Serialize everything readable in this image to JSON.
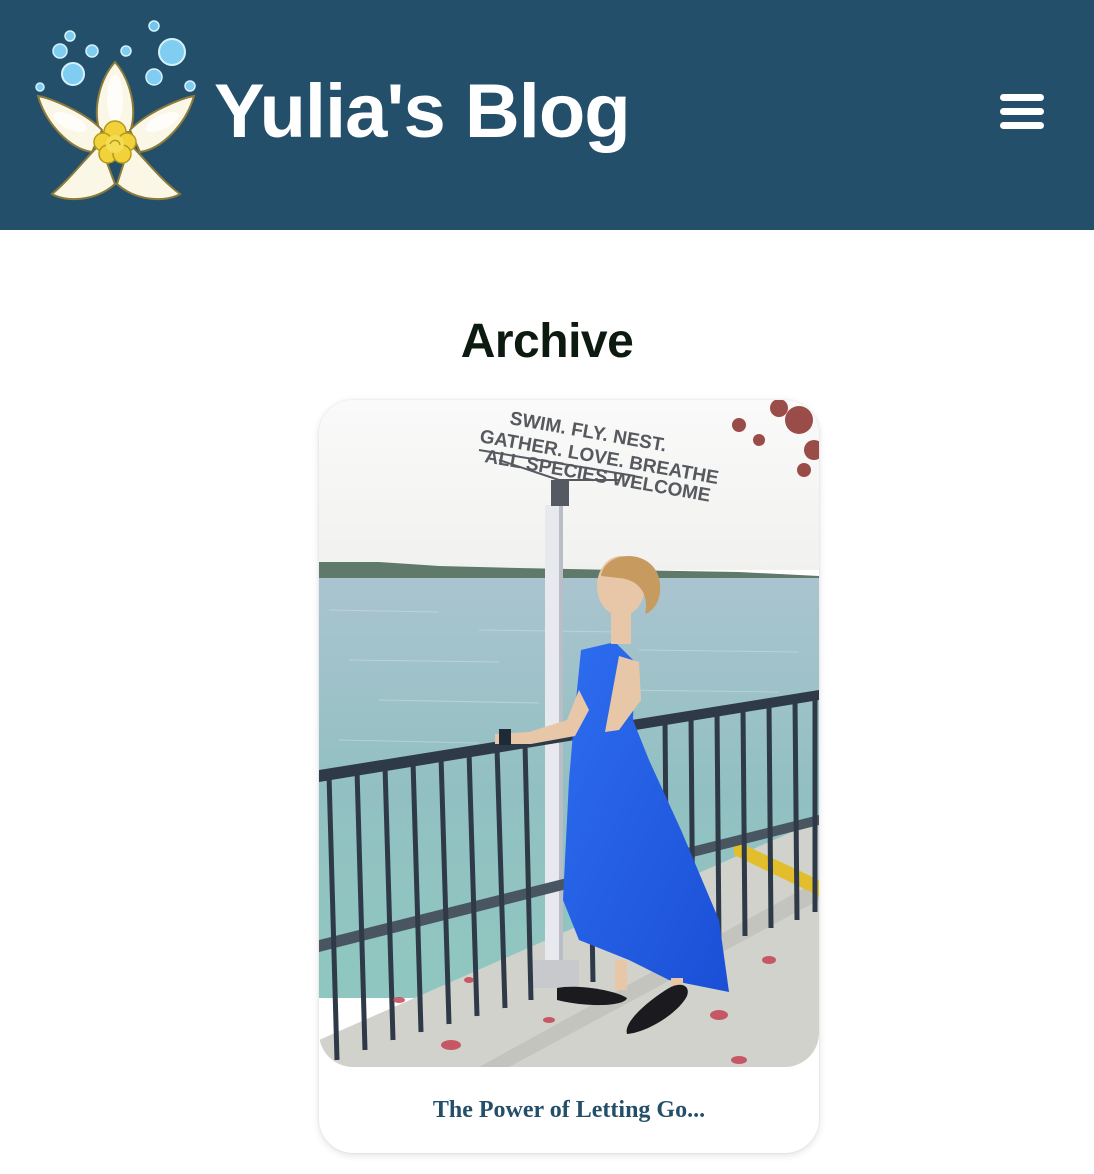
{
  "header": {
    "site_title": "Yulia's Blog",
    "logo_icon": "flower-with-bubbles-icon",
    "menu_icon": "hamburger-menu-icon",
    "background_color": "#244f6b"
  },
  "main": {
    "heading": "Archive",
    "posts": [
      {
        "title": "The Power of Letting Go...",
        "sign_lines": [
          "SWIM. FLY. NEST.",
          "GATHER. LOVE. BREATHE",
          "ALL SPECIES WELCOME"
        ]
      }
    ]
  },
  "colors": {
    "accent": "#244f6b",
    "heading": "#0c1a10"
  }
}
